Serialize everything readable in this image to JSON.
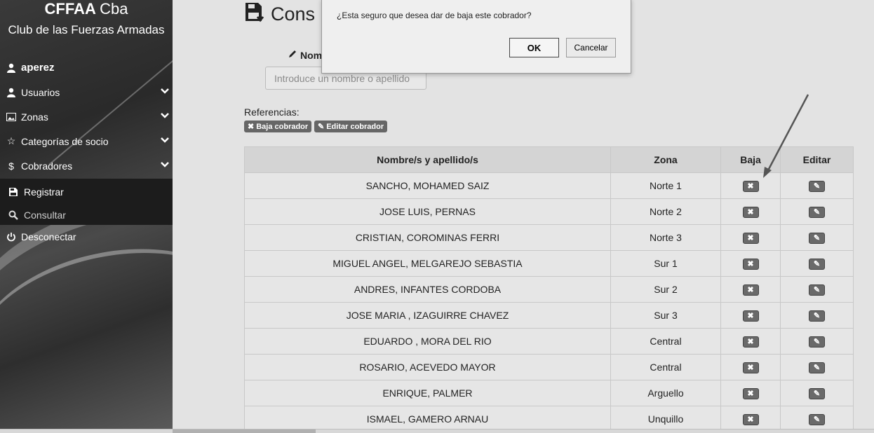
{
  "brand": {
    "title_bold": "CFFAA",
    "title_light": "Cba",
    "subtitle": "Club de las Fuerzas Armadas"
  },
  "sidebar": {
    "user": "aperez",
    "items": [
      {
        "label": "Usuarios",
        "icon": "user-icon"
      },
      {
        "label": "Zonas",
        "icon": "image-icon"
      },
      {
        "label": "Categorías de socio",
        "icon": "star-icon"
      },
      {
        "label": "Cobradores",
        "icon": "dollar-icon"
      }
    ],
    "subitems": [
      {
        "label": "Registrar",
        "icon": "save-icon"
      },
      {
        "label": "Consultar",
        "icon": "search-icon"
      }
    ],
    "logout": "Desconectar"
  },
  "main": {
    "title": "Cons",
    "name_label": "Nom",
    "search_placeholder": "Introduce un nombre o apellido",
    "refs_label": "Referencias:",
    "ref_delete": "Baja cobrador",
    "ref_edit": "Editar cobrador"
  },
  "table": {
    "headers": [
      "Nombre/s y apellido/s",
      "Zona",
      "Baja",
      "Editar"
    ],
    "rows": [
      {
        "name": "SANCHO, MOHAMED SAIZ",
        "zone": "Norte 1"
      },
      {
        "name": "JOSE LUIS, PERNAS",
        "zone": "Norte 2"
      },
      {
        "name": "CRISTIAN, COROMINAS FERRI",
        "zone": "Norte 3"
      },
      {
        "name": "MIGUEL ANGEL, MELGAREJO SEBASTIA",
        "zone": "Sur 1"
      },
      {
        "name": "ANDRES, INFANTES CORDOBA",
        "zone": "Sur 2"
      },
      {
        "name": "JOSE MARIA , IZAGUIRRE CHAVEZ",
        "zone": "Sur 3"
      },
      {
        "name": "EDUARDO , MORA DEL RIO",
        "zone": "Central"
      },
      {
        "name": "ROSARIO, ACEVEDO MAYOR",
        "zone": "Central"
      },
      {
        "name": "ENRIQUE, PALMER",
        "zone": "Arguello"
      },
      {
        "name": "ISMAEL, GAMERO ARNAU",
        "zone": "Unquillo"
      }
    ]
  },
  "dialog": {
    "message": "¿Esta seguro que desea dar de baja este cobrador?",
    "ok": "OK",
    "cancel": "Cancelar"
  }
}
